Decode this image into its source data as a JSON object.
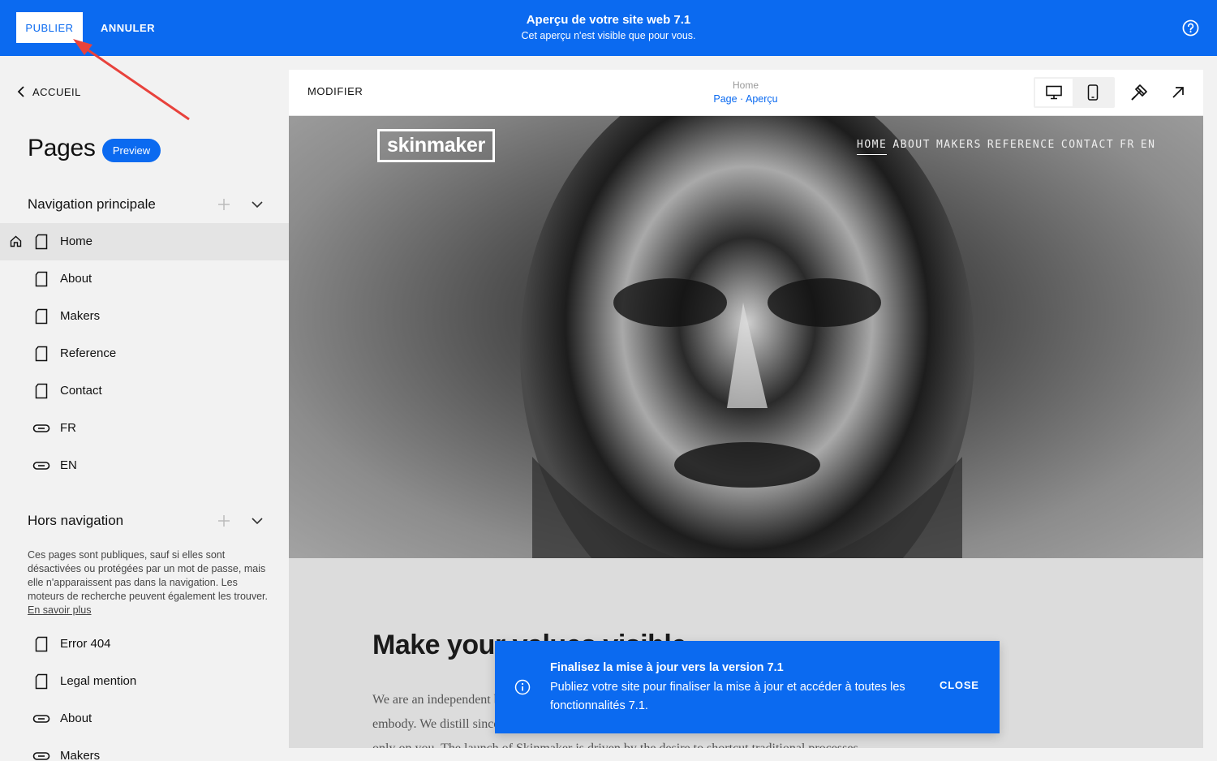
{
  "topbar": {
    "publish_label": "PUBLIER",
    "cancel_label": "ANNULER",
    "title": "Aperçu de votre site web 7.1",
    "subtitle": "Cet aperçu n'est visible que pour vous.",
    "help_icon": "question-circle-icon"
  },
  "sidebar": {
    "back_label": "ACCUEIL",
    "pages_title": "Pages",
    "preview_badge": "Preview",
    "main_nav": {
      "label": "Navigation principale",
      "items": [
        {
          "label": "Home",
          "icon": "page-icon",
          "active": true
        },
        {
          "label": "About",
          "icon": "page-icon"
        },
        {
          "label": "Makers",
          "icon": "page-icon"
        },
        {
          "label": "Reference",
          "icon": "page-icon"
        },
        {
          "label": "Contact",
          "icon": "page-icon"
        },
        {
          "label": "FR",
          "icon": "link-icon"
        },
        {
          "label": "EN",
          "icon": "link-icon"
        }
      ]
    },
    "not_linked": {
      "label": "Hors navigation",
      "description": "Ces pages sont publiques, sauf si elles sont désactivées ou protégées par un mot de passe, mais elle n'apparaissent pas dans la navigation. Les moteurs de recherche peuvent également les trouver.",
      "learn_more": "En savoir plus",
      "items": [
        {
          "label": "Error 404",
          "icon": "page-icon"
        },
        {
          "label": "Legal mention",
          "icon": "page-icon"
        },
        {
          "label": "About",
          "icon": "link-icon"
        },
        {
          "label": "Makers",
          "icon": "link-icon"
        }
      ]
    }
  },
  "preview": {
    "modifier_label": "MODIFIER",
    "crumb_top": "Home",
    "crumb_bottom": "Page · Aperçu",
    "site_logo": "skinmaker",
    "site_nav": [
      "HOME",
      "ABOUT",
      "MAKERS",
      "REFERENCE",
      "CONTACT",
      "FR",
      "EN"
    ],
    "headline": "Make your values visible",
    "body_lines": [
      "We are an independent brand that produces the values you embody.",
      "embody. We distill sincere craftsmanship into products that rely",
      "only on you. The launch of Skinmaker is driven by the desire to shortcut traditional processes."
    ]
  },
  "toast": {
    "title": "Finalisez la mise à jour vers la version 7.1",
    "body": "Publiez votre site pour finaliser la mise à jour et accéder à toutes les fonctionnalités 7.1.",
    "close_label": "CLOSE"
  },
  "colors": {
    "accent": "#0b6af0",
    "annotation_arrow": "#e8423c"
  }
}
